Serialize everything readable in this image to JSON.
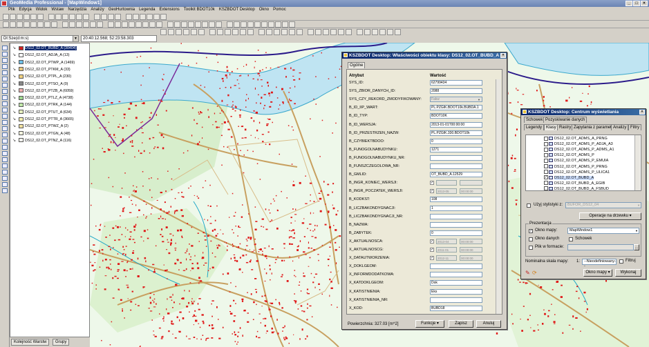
{
  "app": {
    "title": "GeoMedia Professional - [MapWindow1]",
    "menu": [
      "Plik",
      "Edycja",
      "Widok",
      "Wstaw",
      "Narzędzia",
      "Analizy",
      "GeoHurtownia",
      "Legenda",
      "Extensions",
      "Toolkit BDOT10k",
      "KSZBDOT Desktop",
      "Okno",
      "Pomoc"
    ],
    "coord_format": "Dl:Sze(d:m:s)",
    "coord_value": "20:40:12.568; 52:23:58.303"
  },
  "legend": {
    "layers": [
      {
        "label": "DS12_02.OT_BUBD_A (30404)",
        "color": "#d02020",
        "selected": true
      },
      {
        "label": "DS12_02.OT_ADJA_A (13)",
        "color": "#ffffff"
      },
      {
        "label": "DS12_02.OT_PTWP_A (1469)",
        "color": "#6ec0e8"
      },
      {
        "label": "DS12_02.OT_PTKM_A (33)",
        "color": "#e8c880"
      },
      {
        "label": "DS12_02.OT_PTPL_A (230)",
        "color": "#f0d080"
      },
      {
        "label": "DS12_02.OT_PTSO_A (0)",
        "color": "#888888"
      },
      {
        "label": "DS12_02.OT_PTZB_A (6059)",
        "color": "#f0b0b0"
      },
      {
        "label": "DS12_02.OT_PTLZ_A (4738)",
        "color": "#a0d890"
      },
      {
        "label": "DS12_02.OT_PTRK_A (144)",
        "color": "#c0e8a8"
      },
      {
        "label": "DS12_02.OT_PTUT_A (634)",
        "color": "#e8f0c0"
      },
      {
        "label": "DS12_02.OT_PTTR_A (3665)",
        "color": "#f8f0b0"
      },
      {
        "label": "DS12_02.OT_PTWZ_A (2)",
        "color": "#f0e0a0"
      },
      {
        "label": "DS12_02.OT_PTGN_A (48)",
        "color": "#f8f8e0"
      },
      {
        "label": "DS12_02.OT_PTNZ_A (116)",
        "color": "#f8f8f0"
      }
    ],
    "tabs": [
      "Kolejność Warstw",
      "Grupy"
    ]
  },
  "props": {
    "title": "KSZBDOT Desktop: Właściwości obiektu klasy: DS12_02.OT_BUBD_A",
    "tab": "Ogólne",
    "col_attr": "Atrybut",
    "col_val": "Wartość",
    "rows": [
      {
        "name": "SYS_ID:",
        "value": "62799434",
        "kind": "text"
      },
      {
        "name": "SYS_ZBIOR_DANYCH_ID:",
        "value": "2088",
        "kind": "text"
      },
      {
        "name": "SYS_CZY_REKORD_ZMODYFIKOWANY:",
        "value": "Fałsz",
        "kind": "dd-dis"
      },
      {
        "name": "B_ID_IIP_WART:",
        "value": "PL.PZGIK.BDOT10k.BUBDA.1",
        "kind": "text"
      },
      {
        "name": "B_ID_TYP:",
        "value": "BDOT10K",
        "kind": "text"
      },
      {
        "name": "B_ID_WERSJA:",
        "value": "2013-01-01T00:00:00",
        "kind": "text"
      },
      {
        "name": "B_ID_PRZESTRZEN_NAZW:",
        "value": "PL.PZGIK.330.BDOT10k",
        "kind": "text"
      },
      {
        "name": "B_CZYBIEKTBDOO:",
        "value": "0",
        "kind": "text"
      },
      {
        "name": "B_FUNOGOLNABUDYNKU:",
        "value": "1271",
        "kind": "text"
      },
      {
        "name": "B_FUNOGOLNABUDYNKU_NR:",
        "value": "",
        "kind": "text"
      },
      {
        "name": "B_FUNSZCZEGOLOWA_NR:",
        "value": "",
        "kind": "text"
      },
      {
        "name": "B_GMLID:",
        "value": "OT_BUBD_A.12529",
        "kind": "text"
      },
      {
        "name": "B_INGR_KONIEC_WERSJI:",
        "value": "",
        "time": "",
        "kind": "date"
      },
      {
        "name": "B_INGR_POCZATEK_WERSJI:",
        "value": "2013-05",
        "time": "00:00:00",
        "kind": "date"
      },
      {
        "name": "B_KODKST:",
        "value": "108",
        "kind": "text"
      },
      {
        "name": "B_LICZBAKONDYGNACJI:",
        "value": "1",
        "kind": "text"
      },
      {
        "name": "B_LICZBAKONDYGNACJI_NR:",
        "value": "",
        "kind": "text"
      },
      {
        "name": "B_NAZWA:",
        "value": "",
        "kind": "text"
      },
      {
        "name": "B_ZABYTEK:",
        "value": "0",
        "kind": "text"
      },
      {
        "name": "X_AKTUALNOSCA:",
        "value": "2013-04",
        "time": "00:00:00",
        "kind": "date"
      },
      {
        "name": "X_AKTUALNOSCG:",
        "value": "2011-01",
        "time": "00:00:00",
        "kind": "date"
      },
      {
        "name": "X_DATAUTWORZENIA:",
        "value": "2012-11",
        "time": "00:00:00",
        "kind": "date"
      },
      {
        "name": "X_DOKLGEOM:",
        "value": "",
        "kind": "text"
      },
      {
        "name": "X_INFORMDODATKOWA:",
        "value": "",
        "kind": "text"
      },
      {
        "name": "X_KATDOKLGEOM:",
        "value": "Dok",
        "kind": "text"
      },
      {
        "name": "X_KATISTNIENIA:",
        "value": "Eks",
        "kind": "text"
      },
      {
        "name": "X_KATISTNIENIA_NR:",
        "value": "",
        "kind": "text"
      },
      {
        "name": "X_KOD:",
        "value": "BUBD18",
        "kind": "text"
      }
    ],
    "area": "Powierzchnia: 327.03 [m^2]",
    "buttons": {
      "funkcje": "Funkcje",
      "zapisz": "Zapisz",
      "anuluj": "Anuluj"
    }
  },
  "centrum": {
    "title": "KSZBDOT Desktop: Centrum wyświetlania",
    "tabs_top": [
      "Schowek",
      "Pozyskiwanie danych"
    ],
    "tabs": [
      "Legendy",
      "Klasy",
      "Rastry",
      "Zapytania z parametrami",
      "Analizy",
      "Filtry"
    ],
    "items": [
      {
        "label": "DS12_02.OT_ADMS_A_PRNG",
        "checked": false
      },
      {
        "label": "DS12_02.OT_ADMS_P_ADJA_A3",
        "checked": false
      },
      {
        "label": "DS12_02.OT_ADMS_P_ADMS_A1",
        "checked": false
      },
      {
        "label": "DS12_02.OT_ADMS_P",
        "checked": false
      },
      {
        "label": "DS12_02.OT_ADMS_P_EMUIA",
        "checked": false
      },
      {
        "label": "DS12_02.OT_ADMS_P_PRNG",
        "checked": false
      },
      {
        "label": "DS12_02.OT_ADMS_P_ULICA1",
        "checked": false
      },
      {
        "label": "DS12_02.OT_BUBD_A",
        "checked": true
      },
      {
        "label": "DS12_02.OT_BUBD_A_EGIB",
        "checked": false
      },
      {
        "label": "DS12_02.OT_BUBD_A_FSBUD",
        "checked": false
      }
    ],
    "uzyj_label": "Użyj stylistyki z:",
    "uzyj_value": "BUFOR_DS12_04",
    "btn_operacje": "Operacje na drzewku",
    "prezentacja": "Prezentacja",
    "okno_mapy": "Okno mapy:",
    "okno_mapy_value": "MapWindow1",
    "okno_danych": "Okno danych",
    "schowek": "Schowek",
    "plik": "Plik w formacie:",
    "skala_label": "Nominalna skala mapy:",
    "skala_value": "1:",
    "skala_sel": "--Nieodefiniowany--",
    "filtruj": "Filtruj",
    "btn_okno_mapy": "Okno mapy",
    "btn_wykonaj": "Wykonaj"
  },
  "colors": {
    "buildings": "#e01818",
    "roads": "#c8a060",
    "water": "#20a8c8",
    "river": "#b8e0f0",
    "forest": "#a8d898",
    "border": "#2a1a8a"
  }
}
